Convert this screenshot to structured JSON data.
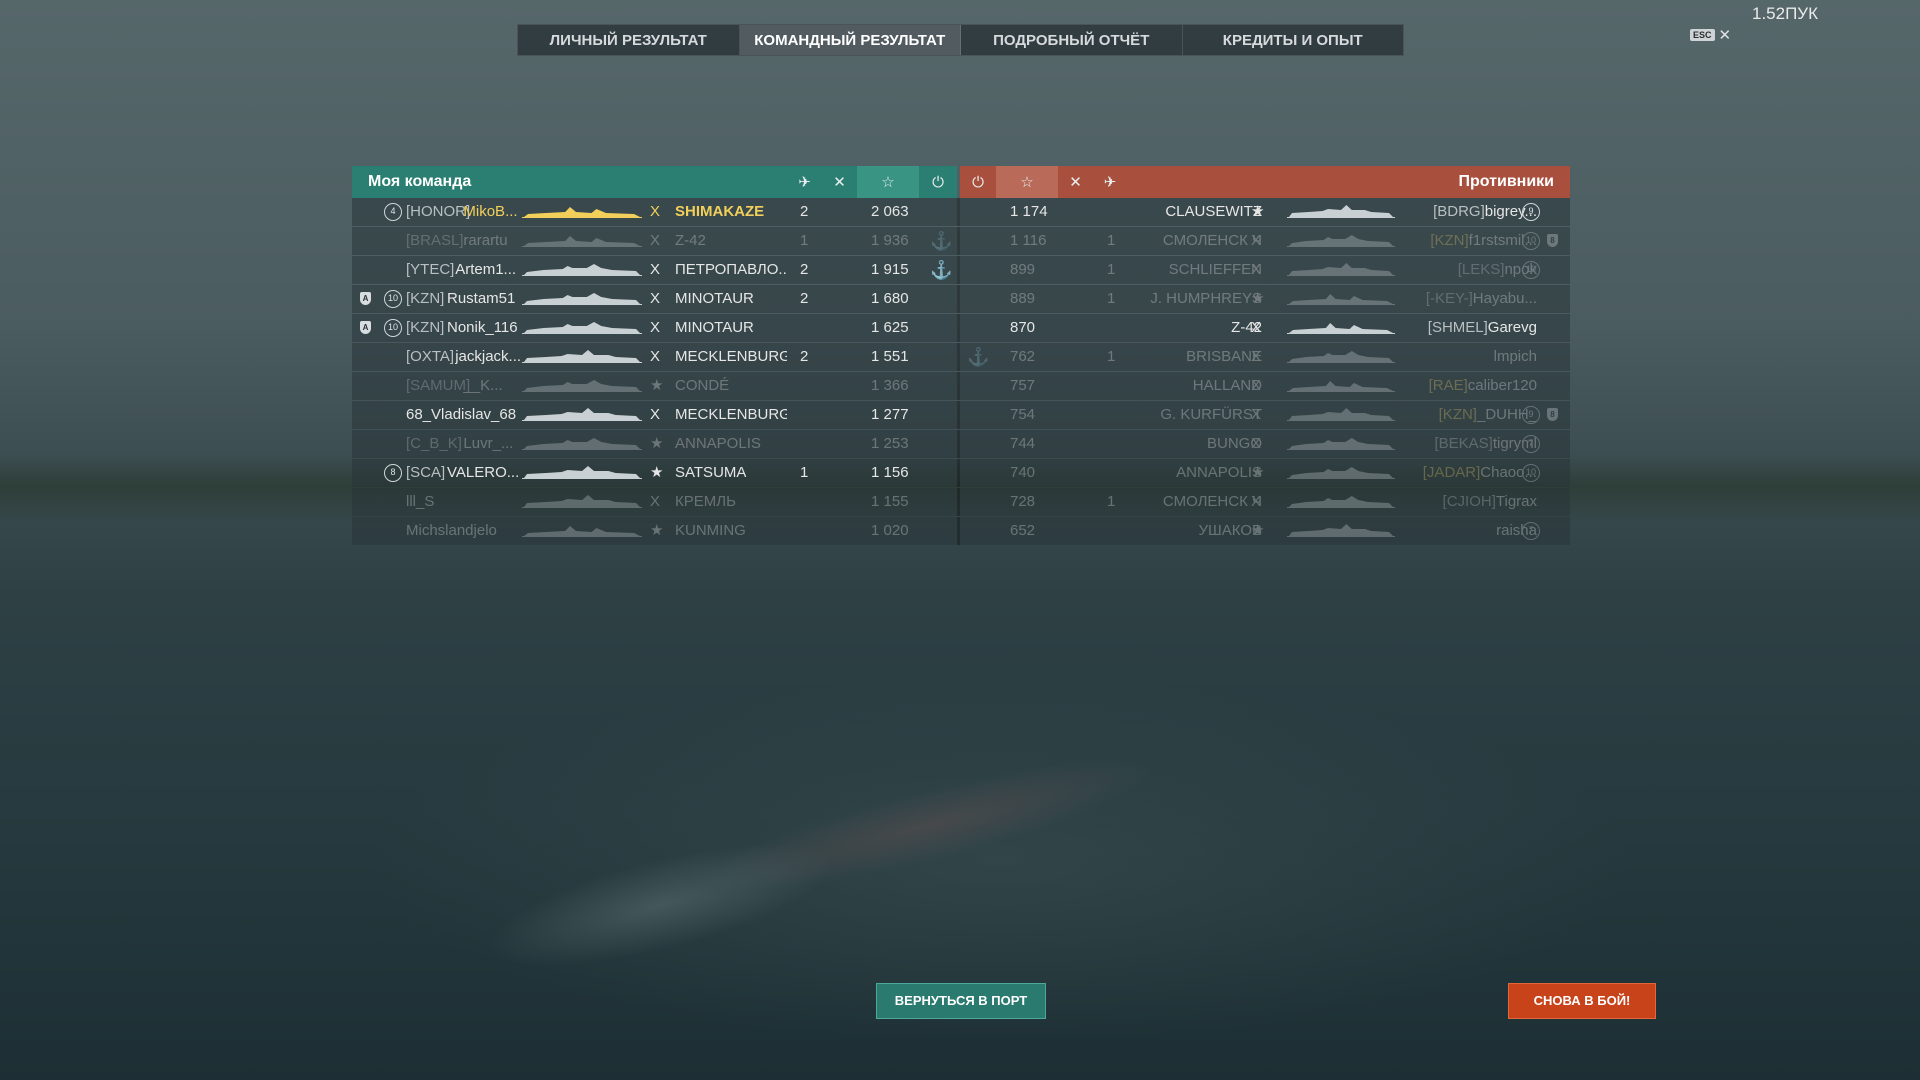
{
  "top_right_label": "1.52ПУК",
  "esc": {
    "key": "ESC",
    "close": "✕"
  },
  "tabs": [
    {
      "label": "ЛИЧНЫЙ РЕЗУЛЬТАТ",
      "active": false
    },
    {
      "label": "КОМАНДНЫЙ РЕЗУЛЬТАТ",
      "active": true
    },
    {
      "label": "ПОДРОБНЫЙ ОТЧЁТ",
      "active": false
    },
    {
      "label": "КРЕДИТЫ И ОПЫТ",
      "active": false
    }
  ],
  "headers": {
    "my_team": "Моя команда",
    "enemies": "Противники",
    "icons": {
      "planes": "✈",
      "kills": "✕",
      "xp": "☆",
      "capture": "⏻"
    }
  },
  "colors": {
    "my_team": "#2a7f72",
    "enemies": "#a8503d",
    "gold": "#f2cf5a",
    "anchor": "#e3b93a",
    "return_btn": "#2b7a70",
    "battle_btn": "#c8421a"
  },
  "my_team": [
    {
      "badge": "4",
      "clan": "[HONOR]",
      "name": "MikoB...",
      "tier": "X",
      "ship": "SHIMAKAZE",
      "kills": "2",
      "xp": "2 063",
      "anchor": false,
      "highlight": true,
      "dim": false,
      "ship_type": "destroyer"
    },
    {
      "badge": "",
      "clan": "[BRASL]",
      "name": "rarartu",
      "tier": "X",
      "ship": "Z-42",
      "kills": "1",
      "xp": "1 936",
      "anchor": true,
      "highlight": false,
      "dim": true,
      "ship_type": "destroyer"
    },
    {
      "badge": "",
      "clan": "[YTEC]",
      "name": "Artem1...",
      "tier": "X",
      "ship": "ПЕТРОПАВЛО...",
      "kills": "2",
      "xp": "1 915",
      "anchor": true,
      "highlight": false,
      "dim": false,
      "ship_type": "cruiser"
    },
    {
      "badge": "10",
      "shield": "A",
      "clan": "[KZN]",
      "name": "Rustam51",
      "tier": "X",
      "ship": "MINOTAUR",
      "kills": "2",
      "xp": "1 680",
      "anchor": false,
      "highlight": false,
      "dim": false,
      "ship_type": "cruiser"
    },
    {
      "badge": "10",
      "shield": "A",
      "clan": "[KZN]",
      "name": "Nonik_116",
      "tier": "X",
      "ship": "MINOTAUR",
      "kills": "",
      "xp": "1 625",
      "anchor": false,
      "highlight": false,
      "dim": false,
      "ship_type": "cruiser"
    },
    {
      "badge": "",
      "clan": "[OXTA]",
      "name": "jackjack...",
      "tier": "X",
      "ship": "MECKLENBURG",
      "kills": "2",
      "xp": "1 551",
      "anchor": false,
      "highlight": false,
      "dim": false,
      "ship_type": "battleship"
    },
    {
      "badge": "",
      "clan": "[SAMUM]",
      "name": "__K...",
      "tier": "★",
      "ship": "CONDÉ",
      "kills": "",
      "xp": "1 366",
      "anchor": false,
      "highlight": false,
      "dim": true,
      "ship_type": "cruiser"
    },
    {
      "badge": "",
      "clan": "",
      "name": "68_Vladislav_68",
      "tier": "X",
      "ship": "MECKLENBURG",
      "kills": "",
      "xp": "1 277",
      "anchor": false,
      "highlight": false,
      "dim": false,
      "ship_type": "battleship"
    },
    {
      "badge": "",
      "clan": "[C_B_K]",
      "name": "Luvr_...",
      "tier": "★",
      "ship": "ANNAPOLIS",
      "kills": "",
      "xp": "1 253",
      "anchor": false,
      "highlight": false,
      "dim": true,
      "ship_type": "cruiser"
    },
    {
      "badge": "8",
      "clan": "[SCA]",
      "name": "VALERO...",
      "tier": "★",
      "ship": "SATSUMA",
      "kills": "1",
      "xp": "1 156",
      "anchor": false,
      "highlight": false,
      "dim": false,
      "ship_type": "battleship"
    },
    {
      "badge": "",
      "clan": "",
      "name": "lll_S",
      "tier": "X",
      "ship": "КРЕМЛЬ",
      "kills": "",
      "xp": "1 155",
      "anchor": false,
      "highlight": false,
      "dim": true,
      "ship_type": "battleship"
    },
    {
      "badge": "",
      "clan": "",
      "name": "Michslandjelo",
      "tier": "★",
      "ship": "KUNMING",
      "kills": "",
      "xp": "1 020",
      "anchor": false,
      "highlight": false,
      "dim": true,
      "ship_type": "destroyer"
    }
  ],
  "enemies": [
    {
      "anchor": false,
      "xp": "1 174",
      "kills": "",
      "ship": "CLAUSEWITZ",
      "tier": "★",
      "clan": "[BDRG]",
      "name": "bigrey...",
      "badge": "9",
      "shield": "",
      "dim": false,
      "ship_type": "battleship"
    },
    {
      "anchor": false,
      "xp": "1 116",
      "kills": "1",
      "ship": "СМОЛЕНСК Ч",
      "tier": "X",
      "clan": "[KZN]",
      "name": "f1rstsmil...",
      "badge": "10",
      "shield": "8",
      "dim": true,
      "ship_type": "cruiser"
    },
    {
      "anchor": false,
      "xp": "899",
      "kills": "1",
      "ship": "SCHLIEFFEN",
      "tier": "X",
      "clan": "[LEKS]",
      "name": "npok",
      "badge": "10",
      "shield": "",
      "dim": true,
      "ship_type": "battleship"
    },
    {
      "anchor": false,
      "xp": "889",
      "kills": "1",
      "ship": "J. HUMPHREYS",
      "tier": "★",
      "clan": "[-KEY-]",
      "name": "Hayabu...",
      "badge": "",
      "shield": "",
      "dim": true,
      "ship_type": "destroyer"
    },
    {
      "anchor": false,
      "xp": "870",
      "kills": "",
      "ship": "Z-42",
      "tier": "X",
      "clan": "[SHMEL]",
      "name": "Garevg",
      "badge": "",
      "shield": "",
      "dim": false,
      "ship_type": "destroyer"
    },
    {
      "anchor": true,
      "xp": "762",
      "kills": "1",
      "ship": "BRISBANE",
      "tier": "X",
      "clan": "",
      "name": "lmpich",
      "badge": "",
      "shield": "",
      "dim": true,
      "ship_type": "cruiser"
    },
    {
      "anchor": false,
      "xp": "757",
      "kills": "",
      "ship": "HALLAND",
      "tier": "X",
      "clan": "[RAE]",
      "name": "caliber120",
      "badge": "",
      "shield": "",
      "dim": true,
      "ship_type": "destroyer"
    },
    {
      "anchor": false,
      "xp": "754",
      "kills": "",
      "ship": "G. KURFÜRST",
      "tier": "X",
      "clan": "[KZN]",
      "name": "_DUHH_",
      "badge": "9",
      "shield": "8",
      "dim": true,
      "ship_type": "battleship"
    },
    {
      "anchor": false,
      "xp": "744",
      "kills": "",
      "ship": "BUNGO",
      "tier": "X",
      "clan": "[BEKAS]",
      "name": "tigryml",
      "badge": "7",
      "shield": "",
      "dim": true,
      "ship_type": "cruiser"
    },
    {
      "anchor": false,
      "xp": "740",
      "kills": "",
      "ship": "ANNAPOLIS",
      "tier": "★",
      "clan": "[JADAR]",
      "name": "Chaoo...",
      "badge": "10",
      "shield": "",
      "dim": true,
      "ship_type": "cruiser"
    },
    {
      "anchor": false,
      "xp": "728",
      "kills": "1",
      "ship": "СМОЛЕНСК Ч",
      "tier": "X",
      "clan": "[CJIOH]",
      "name": "Tigrax",
      "badge": "",
      "shield": "",
      "dim": true,
      "ship_type": "cruiser"
    },
    {
      "anchor": false,
      "xp": "652",
      "kills": "",
      "ship": "УШАКОВ",
      "tier": "★",
      "clan": "",
      "name": "raisha",
      "badge": "7",
      "shield": "",
      "dim": true,
      "ship_type": "battleship"
    }
  ],
  "buttons": {
    "return": "ВЕРНУТЬСЯ В ПОРТ",
    "battle": "СНОВА В БОЙ!"
  }
}
